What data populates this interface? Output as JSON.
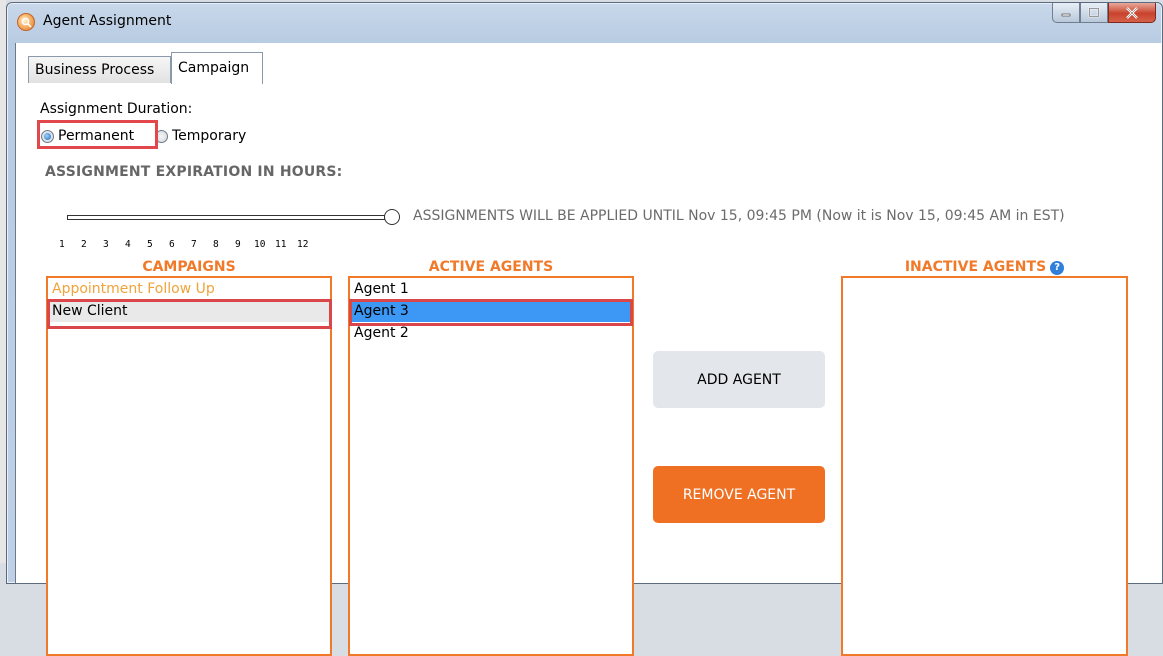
{
  "window": {
    "title": "Agent Assignment"
  },
  "tabs": [
    {
      "label": "Business Process"
    },
    {
      "label": "Campaign"
    }
  ],
  "assignment": {
    "duration_label": "Assignment Duration:",
    "options": [
      {
        "label": "Permanent",
        "selected": true
      },
      {
        "label": "Temporary",
        "selected": false
      }
    ],
    "expiration_label": "ASSIGNMENT EXPIRATION IN HOURS:",
    "apply_text": "ASSIGNMENTS WILL BE APPLIED UNTIL Nov 15, 09:45 PM (Now it is Nov 15, 09:45 AM in EST)",
    "ticks": [
      "1",
      "2",
      "3",
      "4",
      "5",
      "6",
      "7",
      "8",
      "9",
      "10",
      "11",
      "12"
    ],
    "slider_value": 12
  },
  "campaigns": {
    "header": "CAMPAIGNS",
    "items": [
      "Appointment Follow Up",
      "New Client"
    ]
  },
  "active_agents": {
    "header": "ACTIVE AGENTS",
    "items": [
      "Agent 1",
      "Agent 3",
      "Agent 2"
    ]
  },
  "inactive_agents": {
    "header": "INACTIVE AGENTS",
    "help": "?"
  },
  "buttons": {
    "add": "ADD AGENT",
    "remove": "REMOVE AGENT"
  },
  "colors": {
    "accent": "#f07a2a",
    "selection": "#3d97f4",
    "highlight": "#e2474c",
    "remove_bg": "#f07023"
  }
}
